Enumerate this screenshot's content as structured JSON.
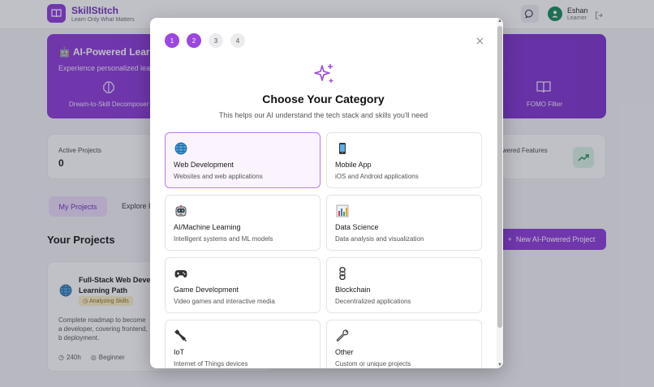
{
  "app": {
    "brand": "SkillStitch",
    "tagline": "Learn Only What Matters",
    "user_name": "Eshan",
    "user_role": "Learner"
  },
  "hero": {
    "title": "AI-Powered Lear",
    "subtitle": "Experience personalized lear",
    "card_left": "Dream-to-Skill Decomposer",
    "card_right": "FOMO Filter"
  },
  "stats": {
    "active_label": "Active Projects",
    "active_value": "0",
    "right_label": "wered Features"
  },
  "tabs": {
    "my_projects": "My Projects",
    "explore": "Explore F"
  },
  "projects": {
    "heading": "Your Projects",
    "new_button": "New AI-Powered Project",
    "card": {
      "title": "Full-Stack Web Deve Learning Path",
      "badge": "Analyzing Skills",
      "description": "Complete roadmap to become a developer, covering frontend, b deployment.",
      "hours": "240h",
      "level": "Beginner"
    }
  },
  "modal": {
    "steps": [
      "1",
      "2",
      "3",
      "4"
    ],
    "title": "Choose Your Category",
    "subtitle": "This helps our AI understand the tech stack and skills you'll need",
    "categories": [
      {
        "name": "Web Development",
        "desc": "Websites and web applications",
        "icon": "globe-icon"
      },
      {
        "name": "Mobile App",
        "desc": "iOS and Android applications",
        "icon": "mobile-phone-icon"
      },
      {
        "name": "AI/Machine Learning",
        "desc": "Intelligent systems and ML models",
        "icon": "robot-icon"
      },
      {
        "name": "Data Science",
        "desc": "Data analysis and visualization",
        "icon": "bar-chart-icon"
      },
      {
        "name": "Game Development",
        "desc": "Video games and interactive media",
        "icon": "gamepad-icon"
      },
      {
        "name": "Blockchain",
        "desc": "Decentralized applications",
        "icon": "chain-icon"
      },
      {
        "name": "IoT",
        "desc": "Internet of Things devices",
        "icon": "satellite-icon"
      },
      {
        "name": "Other",
        "desc": "Custom or unique projects",
        "icon": "wrench-icon"
      }
    ]
  },
  "colors": {
    "accent": "#8a35d9",
    "selected_border": "#b97de8",
    "selected_bg": "#fbf4ff",
    "success": "#0f8a55"
  }
}
